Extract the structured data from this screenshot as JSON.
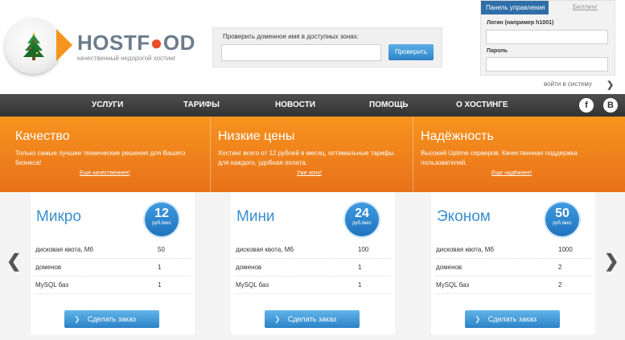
{
  "header": {
    "logo_text_a": "HOST",
    "logo_text_o": "F",
    "logo_text_b": "OD",
    "tagline": "качественный недорогой хостинг"
  },
  "domain_check": {
    "label": "Проверить доменное имя в доступных зонах:",
    "value": "",
    "button": "Проверить"
  },
  "login": {
    "tab_active": "Панель управления",
    "tab_other": "Биллинг",
    "login_label": "Логин (например h1001)",
    "password_label": "Пароль",
    "enter_link": "войти в систему",
    "enter_arrow": "❯"
  },
  "nav": {
    "items": [
      "УСЛУГИ",
      "ТАРИФЫ",
      "НОВОСТИ",
      "ПОМОЩЬ",
      "О ХОСТИНГЕ"
    ],
    "social": [
      "f",
      "B"
    ]
  },
  "features": [
    {
      "title": "Качество",
      "text": "Только самые лучшие технические решения для Вашего бизнеса!",
      "link": "Еще качественнее!"
    },
    {
      "title": "Низкие цены",
      "text": "Хостинг всего от 12 рублей в месяц, оптимальные тарифы для каждого, удобная оплата.",
      "link": "Уже хочу!"
    },
    {
      "title": "Надёжность",
      "text": "Высокий Uptime серверов. Качественная поддержка пользователей.",
      "link": "Еще надёжнее!"
    }
  ],
  "plans": [
    {
      "name": "Микро",
      "price": "12",
      "unit": "руб./мес",
      "specs": [
        [
          "дисковая квота, Мб",
          "50"
        ],
        [
          "доменов",
          "1"
        ],
        [
          "MySQL баз",
          "1"
        ]
      ],
      "button": "Сделать заказ"
    },
    {
      "name": "Мини",
      "price": "24",
      "unit": "руб./мес",
      "specs": [
        [
          "дисковая квота, Мб",
          "100"
        ],
        [
          "доменов",
          "1"
        ],
        [
          "MySQL баз",
          "1"
        ]
      ],
      "button": "Сделать заказ"
    },
    {
      "name": "Эконом",
      "price": "50",
      "unit": "руб./мес",
      "specs": [
        [
          "дисковая квота, Мб",
          "1000"
        ],
        [
          "доменов",
          "2"
        ],
        [
          "MySQL баз",
          "2"
        ]
      ],
      "button": "Сделать заказ"
    }
  ],
  "slider": {
    "prev": "❮",
    "next": "❯"
  },
  "colors": {
    "accent": "#f7931e",
    "brand_blue": "#2f6fa8",
    "nav_bg": "#3d3d3d"
  }
}
